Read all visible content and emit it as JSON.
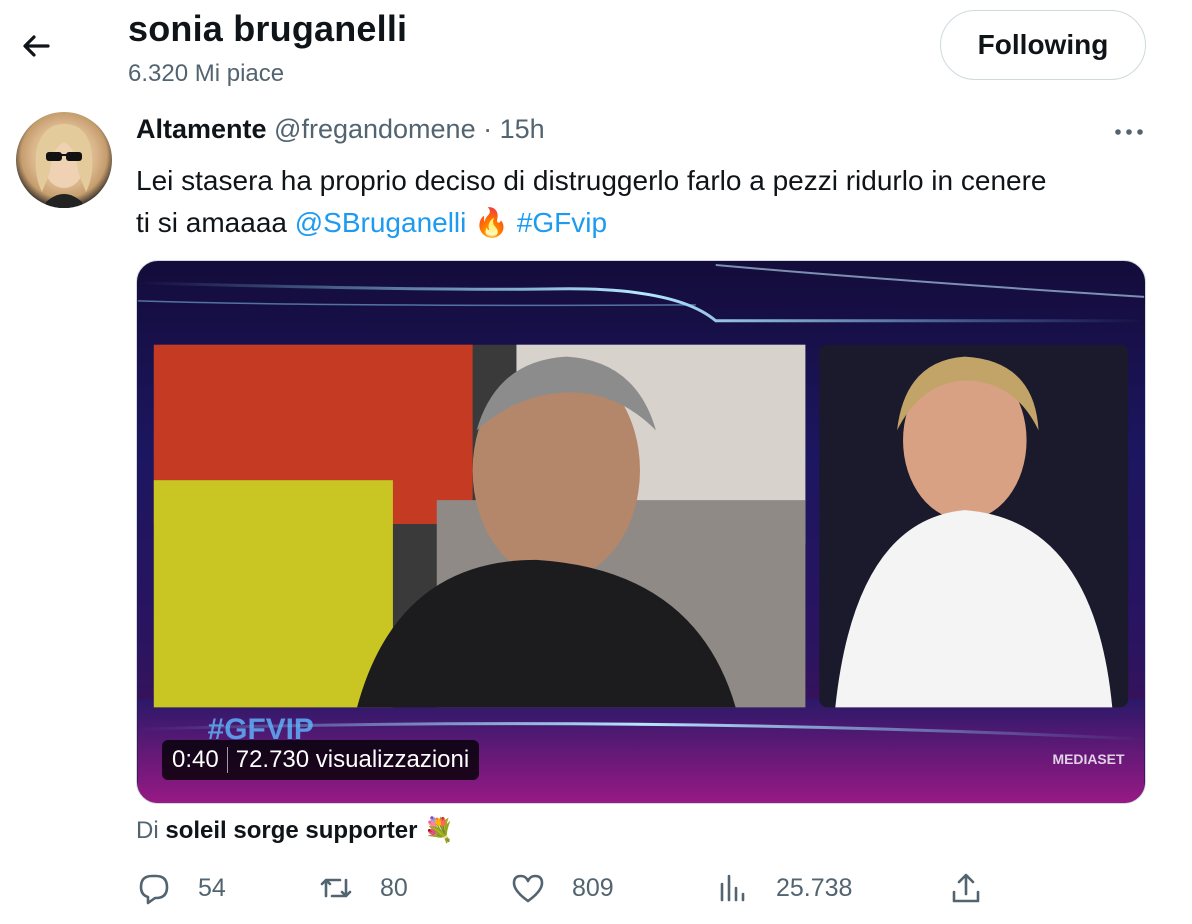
{
  "header": {
    "title": "sonia bruganelli",
    "subtitle": "6.320 Mi piace",
    "follow_label": "Following"
  },
  "tweet": {
    "author_name": "Altamente",
    "author_handle": "@fregandomene",
    "separator": "·",
    "time": "15h",
    "text_line1": "Lei stasera ha proprio deciso di distruggerlo farlo a pezzi ridurlo in cenere",
    "text_line2_prefix": "ti si amaaaa",
    "mention": "@SBruganelli",
    "emoji": "🔥",
    "hashtag": "#GFvip"
  },
  "media": {
    "duration": "0:40",
    "views": "72.730 visualizzazioni",
    "broadcaster": "MEDIASET",
    "show_logo": "#GFVIP"
  },
  "community": {
    "prefix": "Di",
    "name": "soleil sorge supporter",
    "emoji": "💐"
  },
  "actions": {
    "replies": "54",
    "retweets": "80",
    "likes": "809",
    "views": "25.738"
  },
  "icons": {
    "back": "arrow-left-icon",
    "more": "more-horizontal-icon",
    "reply": "reply-icon",
    "retweet": "retweet-icon",
    "like": "heart-icon",
    "analytics": "bar-chart-icon",
    "share": "share-icon"
  },
  "colors": {
    "link": "#1d9bf0",
    "secondary_text": "#536471",
    "primary_text": "#0f1419"
  }
}
